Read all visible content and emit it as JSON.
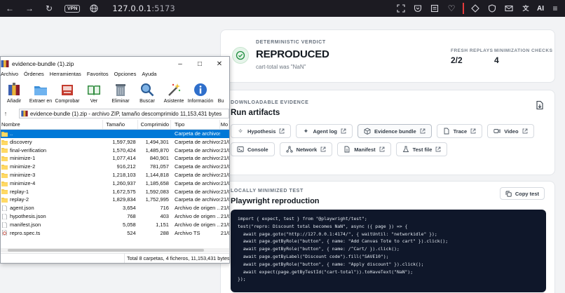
{
  "browser": {
    "vpn_label": "VPN",
    "url_host": "127.0.0.1",
    "url_port": ":5173",
    "ai_label": "AI"
  },
  "verdict": {
    "overline": "DETERMINISTIC VERDICT",
    "title": "REPRODUCED",
    "subtitle": "cart-total was \"NaN\"",
    "stats": [
      {
        "label": "FRESH REPLAYS",
        "value": "2/2"
      },
      {
        "label": "MINIMIZATION CHECKS",
        "value": "4"
      }
    ],
    "accent_color": "#1e8e3e"
  },
  "artifacts": {
    "overline": "DOWNLOADABLE EVIDENCE",
    "title": "Run artifacts",
    "chips": [
      {
        "label": "Hypothesis",
        "icon": "sparkle-icon"
      },
      {
        "label": "Agent log",
        "icon": "wand-icon"
      },
      {
        "label": "Evidence bundle",
        "icon": "package-icon"
      },
      {
        "label": "Trace",
        "icon": "trace-icon"
      },
      {
        "label": "Video",
        "icon": "video-icon"
      },
      {
        "label": "Console",
        "icon": "terminal-icon"
      },
      {
        "label": "Network",
        "icon": "network-icon"
      },
      {
        "label": "Manifest",
        "icon": "file-icon"
      },
      {
        "label": "Test file",
        "icon": "flask-icon"
      }
    ]
  },
  "test": {
    "overline": "LOCALLY MINIMIZED TEST",
    "title": "Playwright reproduction",
    "copy_label": "Copy test",
    "code_lines": [
      "import { expect, test } from \"@playwright/test\";",
      "test(\"repro: Discount total becomes NaN\", async ({ page }) => {",
      "  await page.goto(\"http://127.0.0.1:4174/\", { waitUntil: \"networkidle\" });",
      "  await page.getByRole(\"button\", { name: \"Add Canvas Tote to cart\" }).click();",
      "  await page.getByRole(\"button\", { name: /^Cart/ }).click();",
      "  await page.getByLabel(\"Discount code\").fill(\"SAVE10\");",
      "  await page.getByRole(\"button\", { name: \"Apply discount\" }).click();",
      "  await expect(page.getByTestId(\"cart-total\")).toHaveText(\"NaN\");",
      "});"
    ]
  },
  "zip": {
    "title": "evidence-bundle (1).zip",
    "menu": [
      "Archivo",
      "Órdenes",
      "Herramientas",
      "Favoritos",
      "Opciones",
      "Ayuda"
    ],
    "tools": [
      {
        "label": "Añadir",
        "icon": "add-icon"
      },
      {
        "label": "Extraer en",
        "icon": "folder-extract-icon"
      },
      {
        "label": "Comprobar",
        "icon": "test-icon"
      },
      {
        "label": "Ver",
        "icon": "book-icon"
      },
      {
        "label": "Eliminar",
        "icon": "trash-icon"
      },
      {
        "label": "Buscar",
        "icon": "magnifier-icon"
      },
      {
        "label": "Asistente",
        "icon": "wizard-icon"
      },
      {
        "label": "Información",
        "icon": "info-icon"
      },
      {
        "label": "Bu",
        "icon": "more-icon"
      }
    ],
    "address": "evidence-bundle (1).zip - archivo ZIP, tamaño descomprimido 11,153,431 bytes",
    "columns": [
      "Nombre",
      "Tamaño",
      "Comprimido",
      "Tipo",
      "Mo"
    ],
    "rows": [
      {
        "name": "..",
        "size": "",
        "packed": "",
        "type": "Carpeta de archivos",
        "mod": "",
        "kind": "folder",
        "selected": true
      },
      {
        "name": "discovery",
        "size": "1,597,928",
        "packed": "1,494,301",
        "type": "Carpeta de archivos",
        "mod": "21/0",
        "kind": "folder"
      },
      {
        "name": "final-verification",
        "size": "1,570,424",
        "packed": "1,485,870",
        "type": "Carpeta de archivos",
        "mod": "21/0",
        "kind": "folder"
      },
      {
        "name": "minimize-1",
        "size": "1,077,414",
        "packed": "840,901",
        "type": "Carpeta de archivos",
        "mod": "21/0",
        "kind": "folder"
      },
      {
        "name": "minimize-2",
        "size": "916,212",
        "packed": "781,057",
        "type": "Carpeta de archivos",
        "mod": "21/0",
        "kind": "folder"
      },
      {
        "name": "minimize-3",
        "size": "1,218,103",
        "packed": "1,144,818",
        "type": "Carpeta de archivos",
        "mod": "21/0",
        "kind": "folder"
      },
      {
        "name": "minimize-4",
        "size": "1,260,937",
        "packed": "1,185,658",
        "type": "Carpeta de archivos",
        "mod": "21/0",
        "kind": "folder"
      },
      {
        "name": "replay-1",
        "size": "1,672,575",
        "packed": "1,592,083",
        "type": "Carpeta de archivos",
        "mod": "21/0",
        "kind": "folder"
      },
      {
        "name": "replay-2",
        "size": "1,829,834",
        "packed": "1,752,995",
        "type": "Carpeta de archivos",
        "mod": "21/0",
        "kind": "folder"
      },
      {
        "name": "agent.json",
        "size": "3,654",
        "packed": "716",
        "type": "Archivo de origen ...",
        "mod": "21/0",
        "kind": "file"
      },
      {
        "name": "hypothesis.json",
        "size": "768",
        "packed": "403",
        "type": "Archivo de origen ...",
        "mod": "21/0",
        "kind": "file"
      },
      {
        "name": "manifest.json",
        "size": "5,058",
        "packed": "1,151",
        "type": "Archivo de origen ...",
        "mod": "21/0",
        "kind": "file"
      },
      {
        "name": "repro.spec.ts",
        "size": "524",
        "packed": "288",
        "type": "Archivo TS",
        "mod": "21/0",
        "kind": "ts"
      }
    ],
    "status_left": "",
    "status_right": "Total 8 carpetas, 4 ficheros, 11,153,431 bytes"
  }
}
